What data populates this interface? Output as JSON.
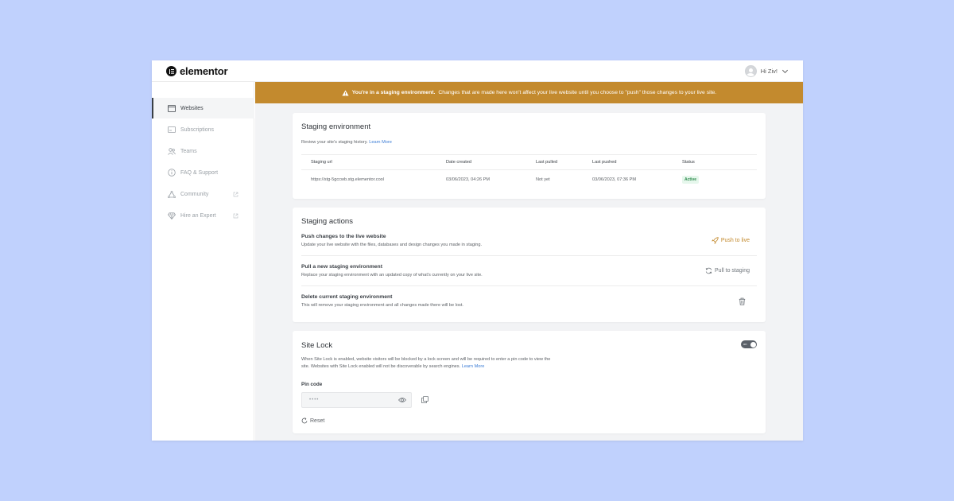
{
  "header": {
    "logo_text": "elementor",
    "greeting": "Hi Ziv!"
  },
  "sidebar": {
    "items": [
      {
        "label": "Websites",
        "icon": "browser-window-icon"
      },
      {
        "label": "Subscriptions",
        "icon": "subscription-card-icon"
      },
      {
        "label": "Teams",
        "icon": "people-icon"
      },
      {
        "label": "FAQ & Support",
        "icon": "info-circle-icon"
      },
      {
        "label": "Community",
        "icon": "community-triangle-icon"
      },
      {
        "label": "Hire an Expert",
        "icon": "diamond-icon"
      }
    ]
  },
  "banner": {
    "strong": "You're in a staging environment.",
    "text": "Changes that are made here won't affect your live website until you choose to \"push\" those changes to your live site."
  },
  "staging_env": {
    "title": "Staging environment",
    "desc": "Review your site's staging history.",
    "learn_more": "Learn More",
    "columns": [
      "Staging url",
      "Date created",
      "Last pulled",
      "Last pushed",
      "Status"
    ],
    "row": {
      "url": "https://stg-5gccwb.stg.elementor.cool",
      "created": "03/06/2023, 04:26 PM",
      "pulled": "Not yet",
      "pushed": "03/06/2023, 07:36 PM",
      "status": "Active"
    }
  },
  "staging_actions": {
    "title": "Staging actions",
    "items": [
      {
        "title": "Push changes to the live website",
        "desc": "Update your live website with the files, databases and design changes you made in staging.",
        "button": "Push to live"
      },
      {
        "title": "Pull a new staging environment",
        "desc": "Replace your staging environment with an updated copy of what's currently on your live site.",
        "button": "Pull to staging"
      },
      {
        "title": "Delete current staging environment",
        "desc": "This will remove your staging environment and all changes made there will be lost.",
        "button": ""
      }
    ]
  },
  "site_lock": {
    "title": "Site Lock",
    "toggle_label": "on",
    "desc_line1": "When Site Lock is enabled, website visitors will be blocked by a lock screen and will be required to enter a pin code to view the",
    "desc_line2": "site. Websites with Site Lock enabled will not be discoverable by search engines.",
    "learn_more": "Learn More",
    "pin_label": "Pin code",
    "pin_value": "••••",
    "reset_label": "Reset"
  },
  "colors": {
    "accent_gold": "#c38a2e",
    "background": "#c0d1fd",
    "status_green": "#2e8b4e",
    "link_blue": "#3a7bd5"
  }
}
